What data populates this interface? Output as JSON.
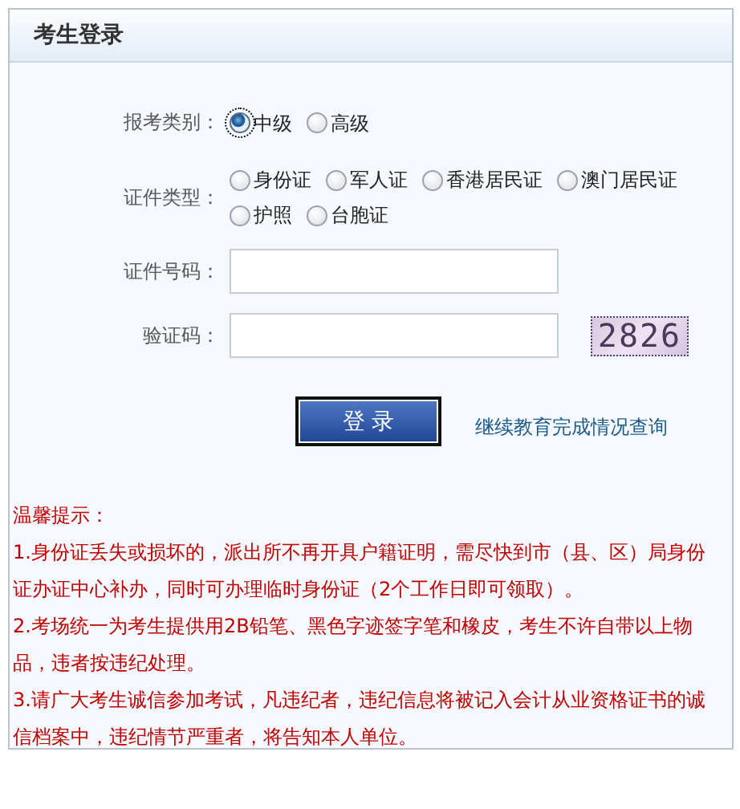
{
  "panel": {
    "title": "考生登录"
  },
  "exam_level": {
    "label": "报考类别：",
    "options": [
      {
        "label": "中级",
        "selected": true
      },
      {
        "label": "高级",
        "selected": false
      }
    ]
  },
  "id_type": {
    "label": "证件类型：",
    "options": [
      {
        "label": "身份证",
        "selected": false
      },
      {
        "label": "军人证",
        "selected": false
      },
      {
        "label": "香港居民证",
        "selected": false
      },
      {
        "label": "澳门居民证",
        "selected": false
      },
      {
        "label": "护照",
        "selected": false
      },
      {
        "label": "台胞证",
        "selected": false
      }
    ]
  },
  "id_number": {
    "label": "证件号码："
  },
  "captcha": {
    "label": "验证码：",
    "code": "2826"
  },
  "login_button": "登 录",
  "query_link": "继续教育完成情况查询",
  "notes": {
    "title": "温馨提示：",
    "items": [
      "1.身份证丢失或损坏的，派出所不再开具户籍证明，需尽快到市（县、区）局身份证办证中心补办，同时可办理临时身份证（2个工作日即可领取）。",
      "2.考场统一为考生提供用2B铅笔、黑色字迹签字笔和橡皮，考生不许自带以上物品，违者按违纪处理。",
      "3.请广大考生诚信参加考试，凡违纪者，违纪信息将被记入会计从业资格证书的诚信档案中，违纪情节严重者，将告知本人单位。"
    ]
  }
}
